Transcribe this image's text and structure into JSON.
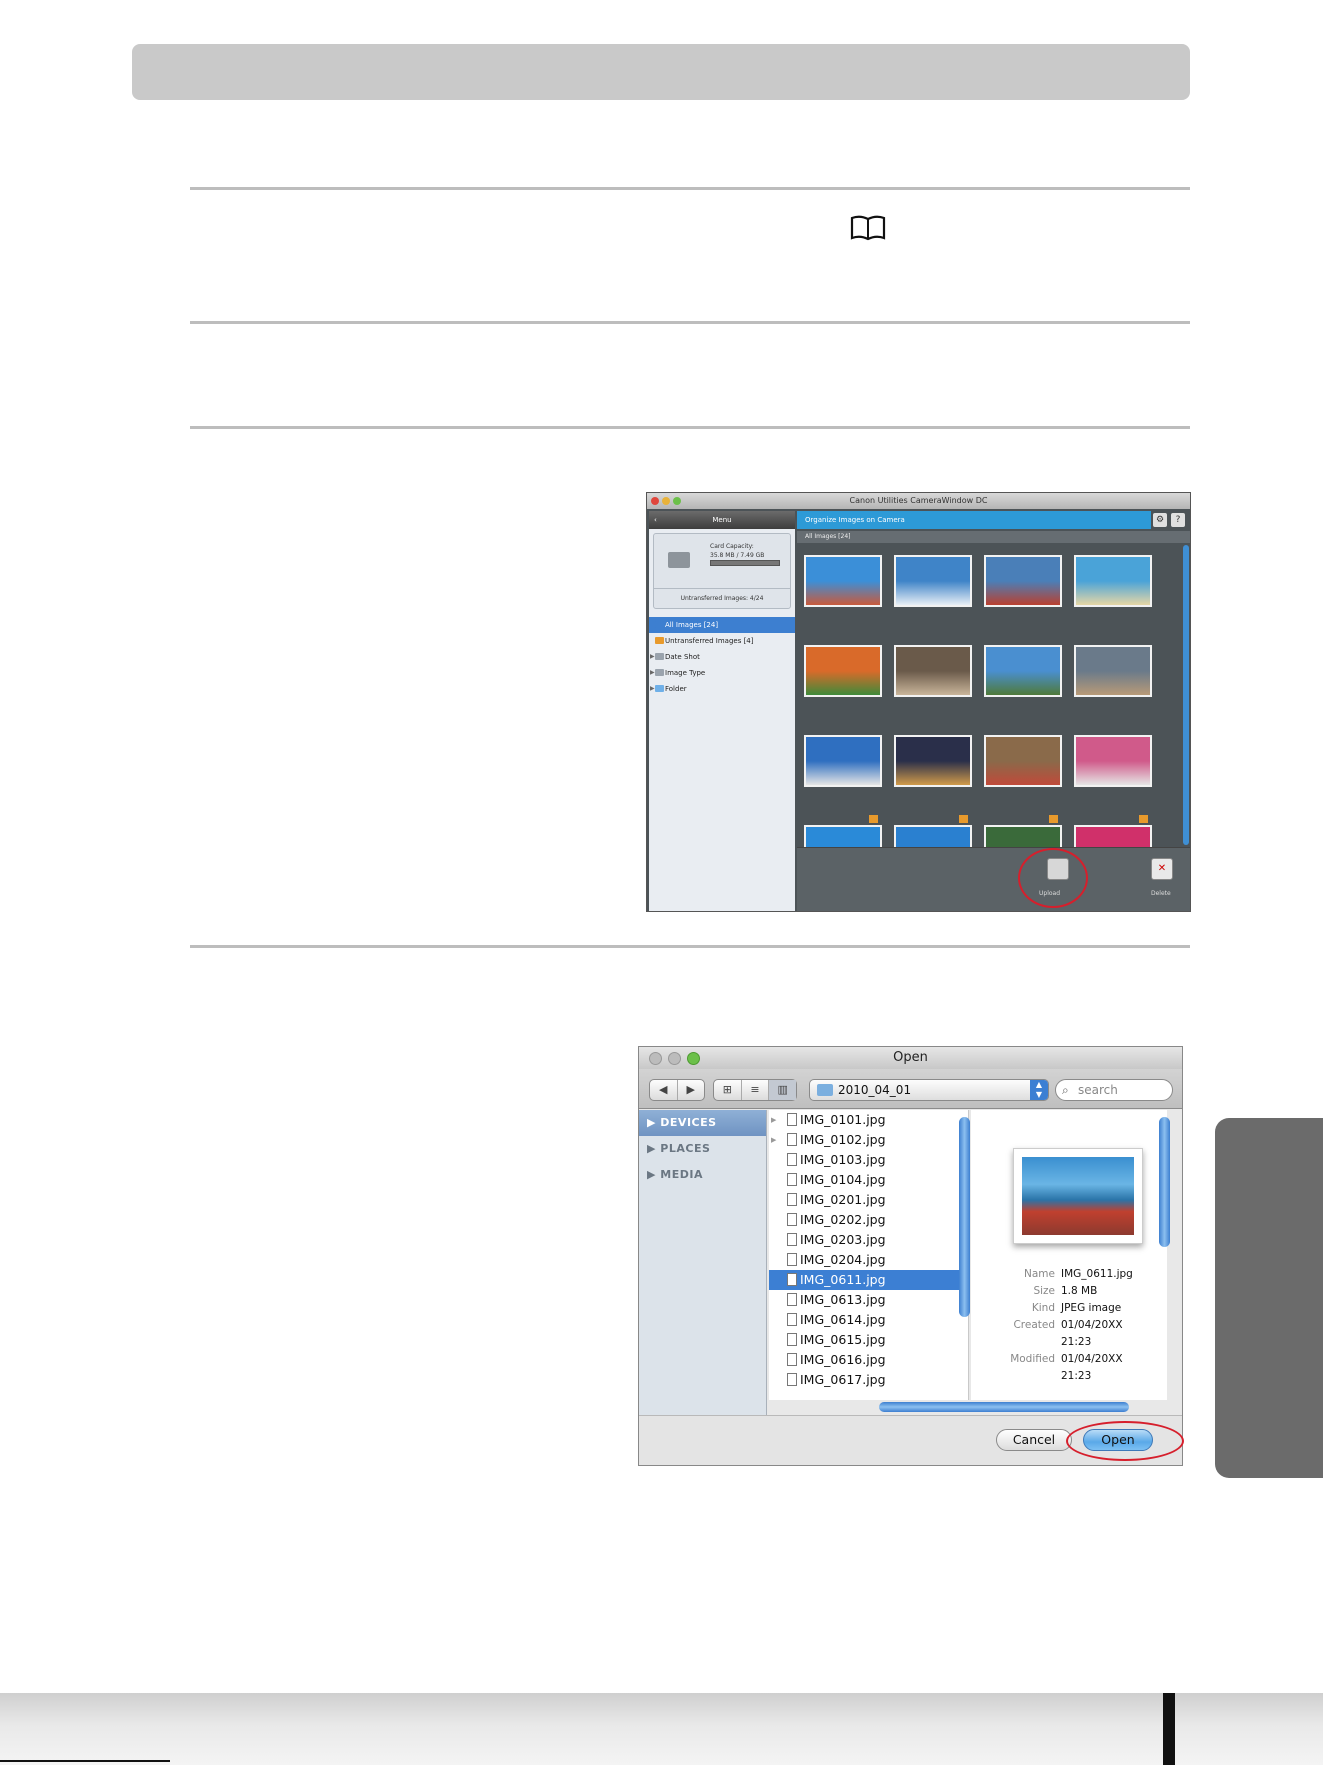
{
  "camerawindow": {
    "title": "Canon Utilities CameraWindow DC",
    "menu_label": "Menu",
    "section_title": "Organize Images on Camera",
    "card_capacity_label": "Card Capacity:",
    "card_capacity_value": "35.8 MB / 7.49 GB",
    "untransferred_label": "Untransferred Images:  4/24",
    "tree": [
      {
        "label": "All Images [24]",
        "color": "#3d7fd0"
      },
      {
        "label": "Untransferred Images [4]",
        "color": "#e89a2c"
      },
      {
        "label": "Date Shot",
        "color": "#9aa3ad"
      },
      {
        "label": "Image Type",
        "color": "#9aa3ad"
      },
      {
        "label": "Folder",
        "color": "#6fb0e8"
      }
    ],
    "grid_header": "All Images [24]",
    "upload_label": "Upload",
    "delete_label": "Delete",
    "delete_glyph": "✕",
    "help_glyph": "?",
    "gear_glyph": "⚙"
  },
  "open_dialog": {
    "title": "Open",
    "folder": "2010_04_01",
    "search_placeholder": "search",
    "sidebar": [
      {
        "label": "▶ DEVICES"
      },
      {
        "label": "▶ PLACES"
      },
      {
        "label": "▶ MEDIA"
      }
    ],
    "files": [
      "IMG_0101.jpg",
      "IMG_0102.jpg",
      "IMG_0103.jpg",
      "IMG_0104.jpg",
      "IMG_0201.jpg",
      "IMG_0202.jpg",
      "IMG_0203.jpg",
      "IMG_0204.jpg",
      "IMG_0611.jpg",
      "IMG_0613.jpg",
      "IMG_0614.jpg",
      "IMG_0615.jpg",
      "IMG_0616.jpg",
      "IMG_0617.jpg"
    ],
    "selected_file": "IMG_0611.jpg",
    "meta": {
      "name_k": "Name",
      "name_v": "IMG_0611.jpg",
      "size_k": "Size",
      "size_v": "1.8 MB",
      "kind_k": "Kind",
      "kind_v": "JPEG image",
      "created_k": "Created",
      "created_v": "01/04/20XX",
      "created_t": "21:23",
      "modified_k": "Modified",
      "modified_v": "01/04/20XX",
      "modified_t": "21:23"
    },
    "cancel_label": "Cancel",
    "open_label": "Open"
  },
  "colors": {
    "highlight_ring": "#d61f2c",
    "accent_blue": "#2d9ad7"
  }
}
